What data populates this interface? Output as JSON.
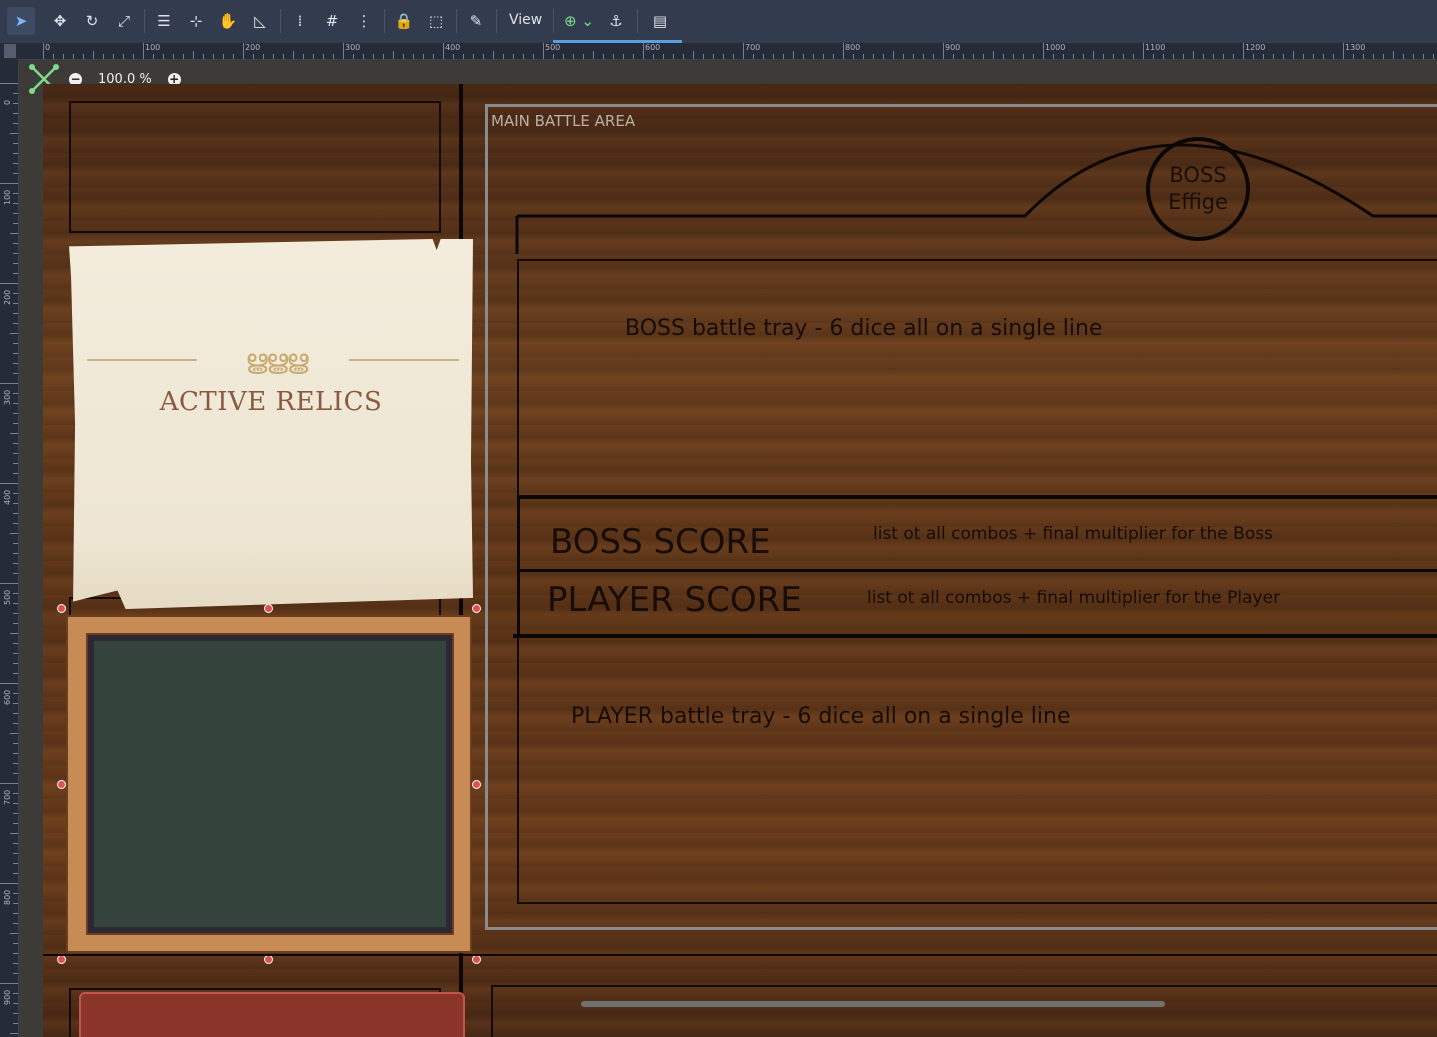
{
  "toolbar": {
    "view_label": "View"
  },
  "zoom": {
    "level": "100.0 %",
    "minus": "−",
    "plus": "+"
  },
  "ruler": {
    "top_labels": [
      "0",
      "100",
      "200",
      "300",
      "400",
      "500",
      "600",
      "700",
      "800",
      "900",
      "1000",
      "1100",
      "1200",
      "1300"
    ],
    "left_labels": [
      "0",
      "100",
      "200",
      "300",
      "400",
      "500",
      "600",
      "700",
      "800",
      "900"
    ]
  },
  "scene": {
    "relics_title": "ACTIVE RELICS",
    "relics_ornament": "ൠൠൠ",
    "battle_area_label": "MAIN BATTLE AREA",
    "boss_effigy_line1": "BOSS",
    "boss_effigy_line2": "Effige",
    "boss_tray": "BOSS battle tray - 6 dice all on a single line",
    "boss_score": "BOSS SCORE",
    "boss_combos": "list ot all combos + final multiplier for the Boss",
    "player_score": "PLAYER SCORE",
    "player_combos": "list ot all combos + final multiplier for the Player",
    "player_tray": "PLAYER battle tray - 6 dice all on a single line"
  }
}
